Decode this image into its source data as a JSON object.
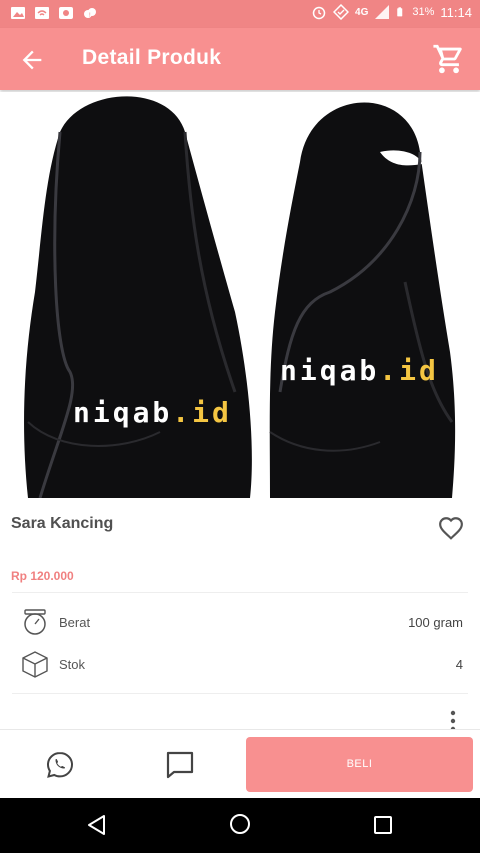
{
  "status_bar": {
    "icons_left": [
      "image-icon",
      "wifi-icon",
      "screen-record-icon",
      "weather-icon"
    ],
    "icons_right": [
      "alarm-icon",
      "data-saver-icon",
      "signal-4g-icon",
      "battery-icon"
    ],
    "network": "4G",
    "battery": "31%",
    "time": "11:14"
  },
  "app_bar": {
    "title": "Detail Produk",
    "back_icon": "arrow-left-icon",
    "cart_icon": "shopping-cart-icon"
  },
  "product": {
    "image_watermark_left": [
      "niqab",
      ".id"
    ],
    "image_watermark_right": [
      "niqab",
      ".id"
    ],
    "name": "Sara Kancing",
    "price": "Rp 120.000",
    "favorite_icon": "heart-outline-icon",
    "specs": [
      {
        "icon": "scale-icon",
        "label": "Berat",
        "value": "100 gram"
      },
      {
        "icon": "box-icon",
        "label": "Stok",
        "value": "4"
      }
    ]
  },
  "bottom_bar": {
    "whatsapp_icon": "whatsapp-icon",
    "chat_icon": "chat-icon",
    "buy_label": "BELI"
  },
  "colors": {
    "accent": "#f89090",
    "status_bar": "#f08585",
    "price": "#f08080"
  }
}
